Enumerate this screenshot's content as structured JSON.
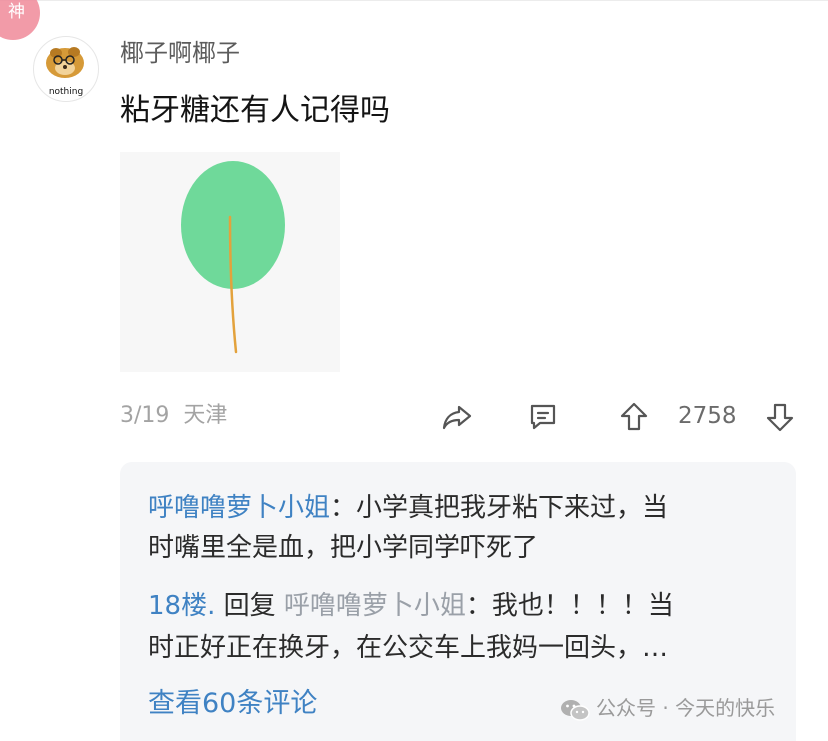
{
  "badge": {
    "label": "神"
  },
  "comment": {
    "avatar_text": "nothing",
    "username": "椰子啊椰子",
    "text": "粘牙糖还有人记得吗",
    "date": "3/19",
    "location": "天津",
    "vote_count": "2758"
  },
  "replies": [
    {
      "user": "呼噜噜萝卜小姐",
      "line1_text": "：小学真把我牙粘下来过，当",
      "line2_text": "时嘴里全是血，把小学同学吓死了"
    },
    {
      "floor": "18楼.",
      "reply_word": " 回复 ",
      "replied_user": "呼噜噜萝卜小姐",
      "line1_text": "：我也！！！！当",
      "line2_text": "时正好正在换牙，在公交车上我妈一回头，…"
    }
  ],
  "view_more_label": "查看60条评论",
  "watermark": "公众号 · 今天的快乐",
  "icons": {
    "share": "share-icon",
    "comment": "comment-icon",
    "upvote": "upvote-icon",
    "downvote": "downvote-icon",
    "wechat": "wechat-icon"
  },
  "colors": {
    "link_blue": "#3f82c3",
    "badge_pink": "#f08a9a",
    "leaf_green": "#6fd99a",
    "stem_orange": "#e3a23c"
  }
}
